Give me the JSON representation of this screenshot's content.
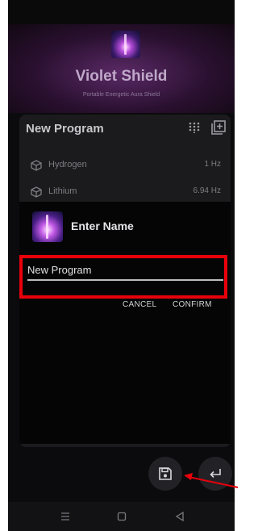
{
  "app": {
    "title": "Violet Shield",
    "subtitle": "Portable Energetic Aura Shield"
  },
  "program": {
    "title": "New Program",
    "items": [
      {
        "name": "Hydrogen",
        "frequency": "1 Hz"
      },
      {
        "name": "Lithium",
        "frequency": "6.94 Hz"
      }
    ]
  },
  "dialog": {
    "title": "Enter Name",
    "input_value": "New Program",
    "cancel_label": "CANCEL",
    "confirm_label": "CONFIRM"
  },
  "icons": {
    "grid": "dialpad-grid-icon",
    "add_list": "add-to-list-icon",
    "item": "atom-cube-icon",
    "save": "save-floppy-icon",
    "back": "return-arrow-icon",
    "nav": [
      "menu-icon",
      "home-square-icon",
      "back-triangle-icon"
    ]
  },
  "colors": {
    "highlight": "#e8000b",
    "accent_violet": "#bfa8c8"
  }
}
